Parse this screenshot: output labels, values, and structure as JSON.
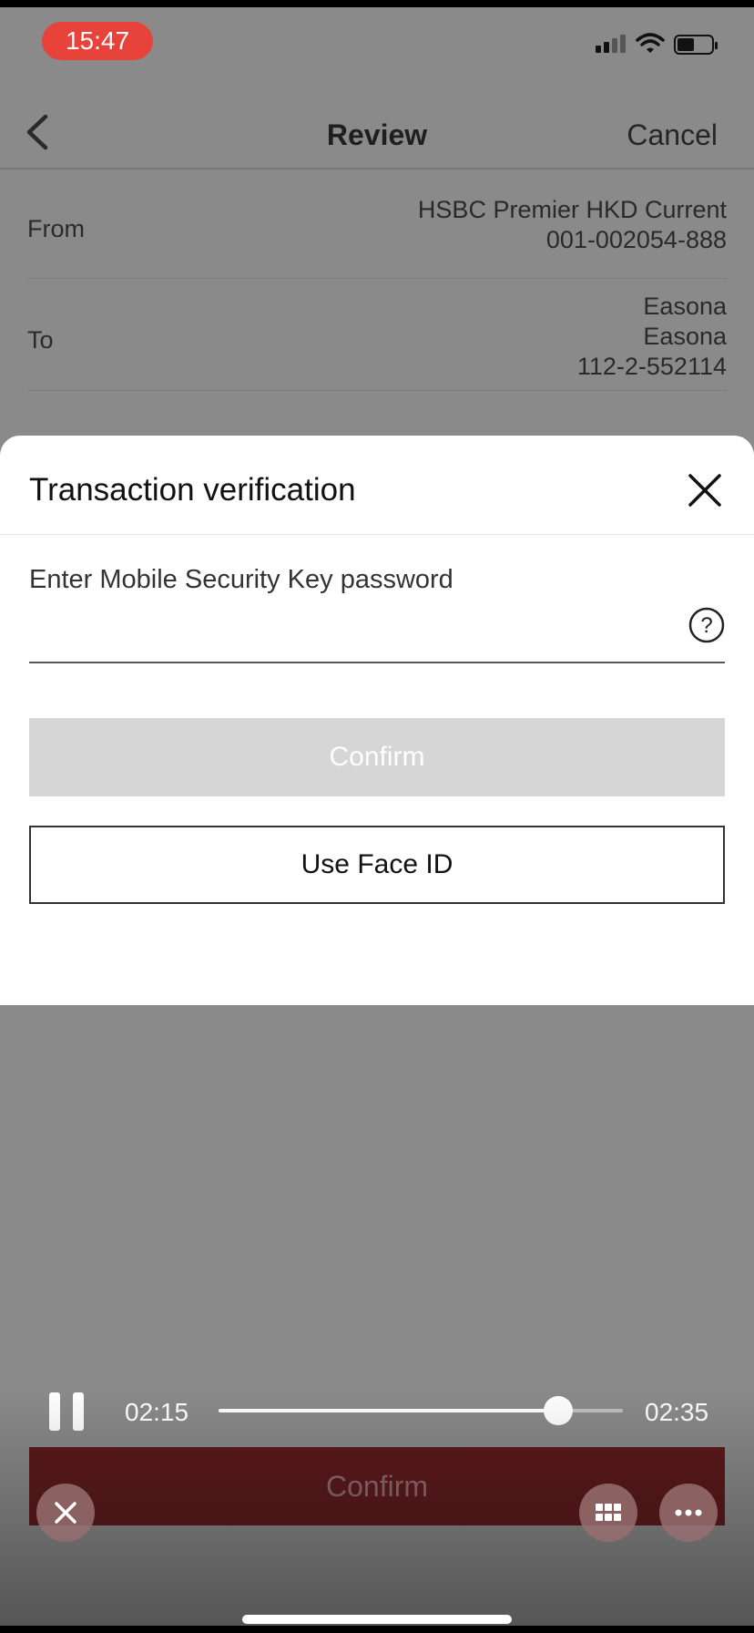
{
  "status_bar": {
    "time": "15:47"
  },
  "nav": {
    "title": "Review",
    "cancel_label": "Cancel"
  },
  "review": {
    "from_label": "From",
    "from_account_name": "HSBC Premier HKD Current",
    "from_account_number": "001-002054-888",
    "to_label": "To",
    "to_name_line1": "Easona",
    "to_name_line2": "Easona",
    "to_account_number": "112-2-552114"
  },
  "sheet": {
    "title": "Transaction verification",
    "password_label": "Enter Mobile Security Key password",
    "password_value": "",
    "confirm_label": "Confirm",
    "face_id_label": "Use Face ID"
  },
  "video": {
    "current_time": "02:15",
    "total_time": "02:35",
    "progress": 0.84
  },
  "bottom": {
    "confirm_label": "Confirm"
  },
  "icons": {
    "back": "chevron-left-icon",
    "close": "close-icon",
    "help": "question-circle-icon",
    "pause": "pause-icon",
    "grid": "grid-icon",
    "more": "more-icon"
  },
  "colors": {
    "time_pill": "#e8433a",
    "brand_confirm": "#5c1a1c",
    "disabled_button": "#d6d6d6"
  }
}
